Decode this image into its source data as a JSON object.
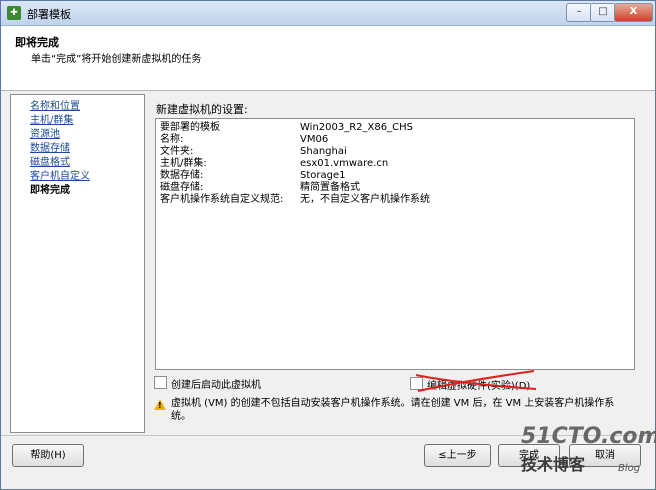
{
  "window": {
    "title": "部署模板",
    "minimize_label": "–",
    "maximize_label": "□",
    "close_label": "X"
  },
  "header": {
    "title": "即将完成",
    "subtitle": "单击“完成”将开始创建新虚拟机的任务"
  },
  "nav": {
    "items": [
      {
        "label": "名称和位置"
      },
      {
        "label": "主机/群集"
      },
      {
        "label": "资源池"
      },
      {
        "label": "数据存储"
      },
      {
        "label": "磁盘格式"
      },
      {
        "label": "客户机自定义"
      },
      {
        "label": "即将完成"
      }
    ]
  },
  "settings": {
    "label": "新建虚拟机的设置:",
    "rows": [
      {
        "key": "要部署的模板",
        "value": "Win2003_R2_X86_CHS"
      },
      {
        "key": "名称:",
        "value": "VM06"
      },
      {
        "key": "文件夹:",
        "value": "Shanghai"
      },
      {
        "key": "主机/群集:",
        "value": "esx01.vmware.cn"
      },
      {
        "key": "数据存储:",
        "value": "Storage1"
      },
      {
        "key": "磁盘存储:",
        "value": "精简置备格式"
      },
      {
        "key": "客户机操作系统自定义规范:",
        "value": "无，不自定义客户机操作系统"
      }
    ]
  },
  "options": {
    "power_on_label": "创建后启动此虚拟机",
    "power_on_checked": false,
    "edit_hw_label": "编辑虚拟硬件(实验)(D)",
    "edit_hw_checked": false
  },
  "warning": {
    "text": "虚拟机 (VM) 的创建不包括自动安装客户机操作系统。请在创建 VM 后，在 VM 上安装客户机操作系统。"
  },
  "footer": {
    "help_label": "帮助(H)",
    "back_label": "≤上一步",
    "finish_label": "完成",
    "cancel_label": "取消"
  },
  "watermark": {
    "site": "51CTO.com",
    "sub": "技术博客",
    "blog": "Blog"
  },
  "colors": {
    "link": "#1c4a9a",
    "strike": "#e0201a",
    "warning": "#e8b30a"
  }
}
